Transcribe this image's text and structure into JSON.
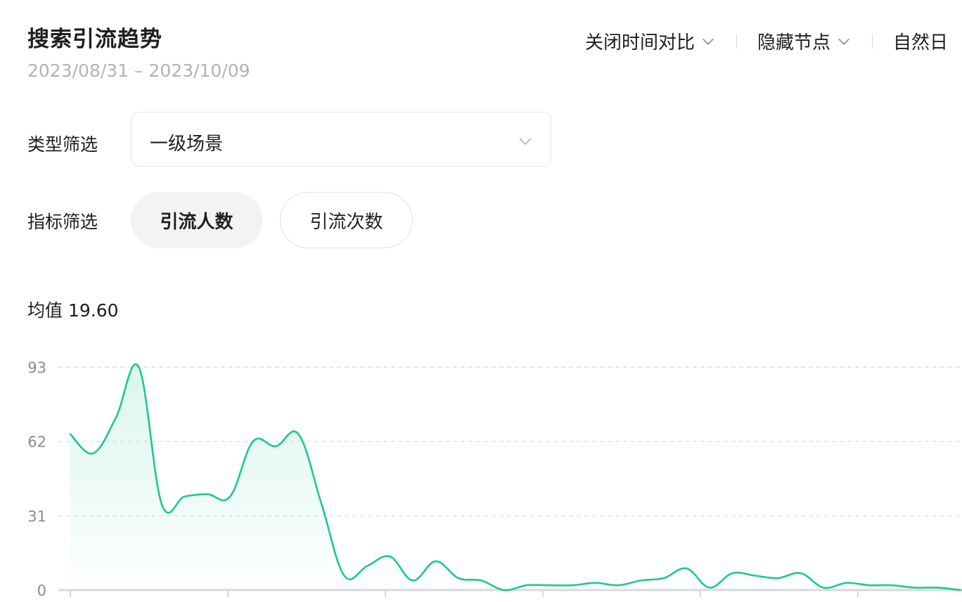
{
  "header": {
    "title": "搜索引流趋势",
    "date_range": "2023/08/31 – 2023/10/09",
    "controls": [
      "关闭时间对比",
      "隐藏节点",
      "自然日"
    ]
  },
  "filters": {
    "type_label": "类型筛选",
    "type_value": "一级场景",
    "metric_label": "指标筛选",
    "metric_options": [
      "引流人数",
      "引流次数"
    ],
    "metric_active": "引流人数"
  },
  "average": {
    "label": "均值",
    "value": "19.60"
  },
  "colors": {
    "line": "#1ec98a",
    "grid": "#dde3ea",
    "axis": "#d9d9d9"
  },
  "chart_data": {
    "type": "area",
    "title": "",
    "xlabel": "",
    "ylabel": "",
    "ylim": [
      0,
      93
    ],
    "yticks": [
      0,
      31,
      62,
      93
    ],
    "x": [
      "2023-08-31",
      "2023-09-01",
      "2023-09-02",
      "2023-09-03",
      "2023-09-04",
      "2023-09-05",
      "2023-09-06",
      "2023-09-07",
      "2023-09-08",
      "2023-09-09",
      "2023-09-10",
      "2023-09-11",
      "2023-09-12",
      "2023-09-13",
      "2023-09-14",
      "2023-09-15",
      "2023-09-16",
      "2023-09-17",
      "2023-09-18",
      "2023-09-19",
      "2023-09-20",
      "2023-09-21",
      "2023-09-22",
      "2023-09-23",
      "2023-09-24",
      "2023-09-25",
      "2023-09-26",
      "2023-09-27",
      "2023-09-28",
      "2023-09-29",
      "2023-09-30",
      "2023-10-01",
      "2023-10-02",
      "2023-10-03",
      "2023-10-04",
      "2023-10-05",
      "2023-10-06",
      "2023-10-07",
      "2023-10-08",
      "2023-10-09"
    ],
    "series": [
      {
        "values": [
          65,
          57,
          72,
          93,
          36,
          39,
          40,
          39,
          62,
          60,
          65,
          36,
          6,
          10,
          14,
          4,
          12,
          5,
          4,
          0,
          2,
          2,
          2,
          3,
          2,
          4,
          5,
          9,
          1,
          7,
          6,
          5,
          7,
          1,
          3,
          2,
          2,
          1,
          1,
          0
        ]
      }
    ],
    "grid": true,
    "legend": "none"
  }
}
